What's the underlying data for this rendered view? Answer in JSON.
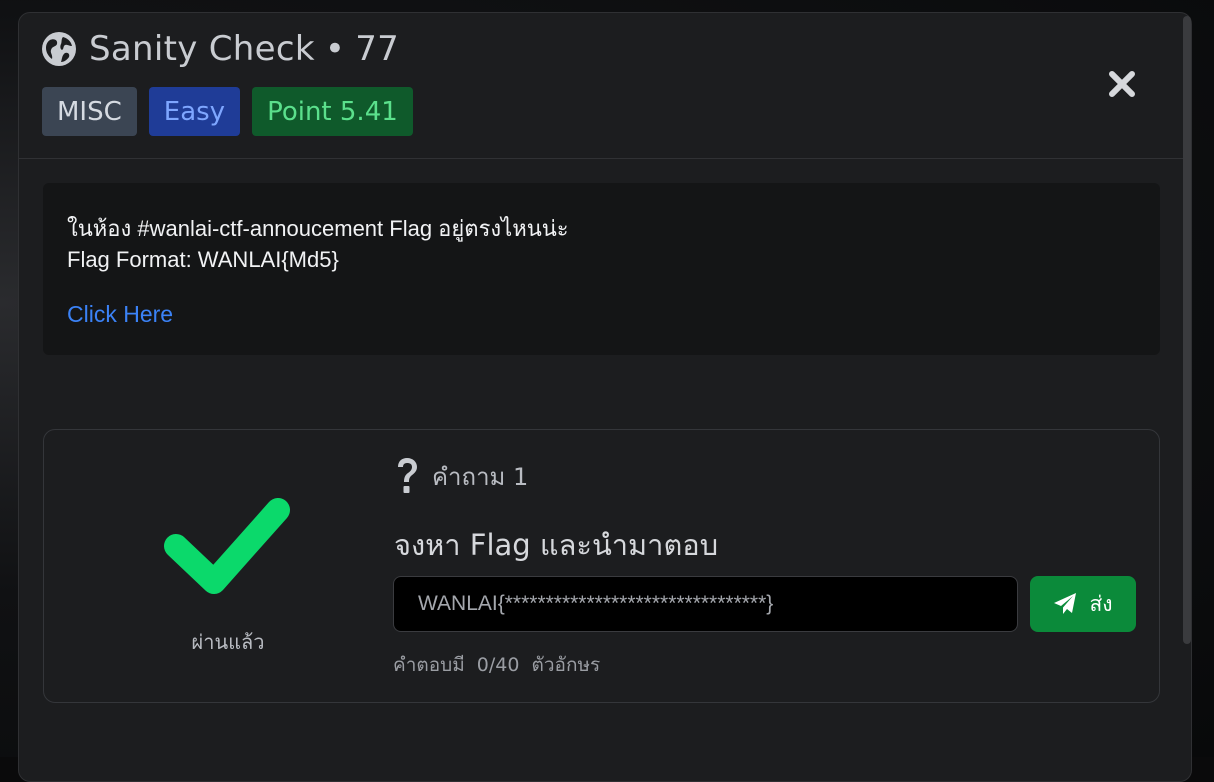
{
  "header": {
    "icon": "globe-icon",
    "title": "Sanity Check",
    "separator": "•",
    "number": "77",
    "badges": {
      "category": "MISC",
      "difficulty": "Easy",
      "points": "Point 5.41"
    },
    "close_icon": "close-icon"
  },
  "description": {
    "line1": "ในห้อง #wanlai-ctf-annoucement Flag อยู่ตรงไหนน่ะ",
    "line2": "Flag Format: WANLAI{Md5}",
    "link_text": "Click Here"
  },
  "question": {
    "status_icon": "check-icon",
    "status_label": "ผ่านแล้ว",
    "heading_icon": "question-icon",
    "heading": "คำถาม 1",
    "prompt": "จงหา Flag และนำมาตอบ",
    "answer_value": "WANLAI{********************************}",
    "submit_label": "ส่ง",
    "submit_icon": "paper-plane-icon",
    "counter_text": "คำตอบมี  0/40  ตัวอักษร"
  },
  "colors": {
    "modal_bg": "#1c1d1f",
    "badge_misc": "#3b4553",
    "badge_easy": "#1f3c97",
    "badge_point": "#0f5a2b",
    "success": "#0bd96b",
    "submit": "#0b8a3a",
    "link": "#3b82f6"
  }
}
